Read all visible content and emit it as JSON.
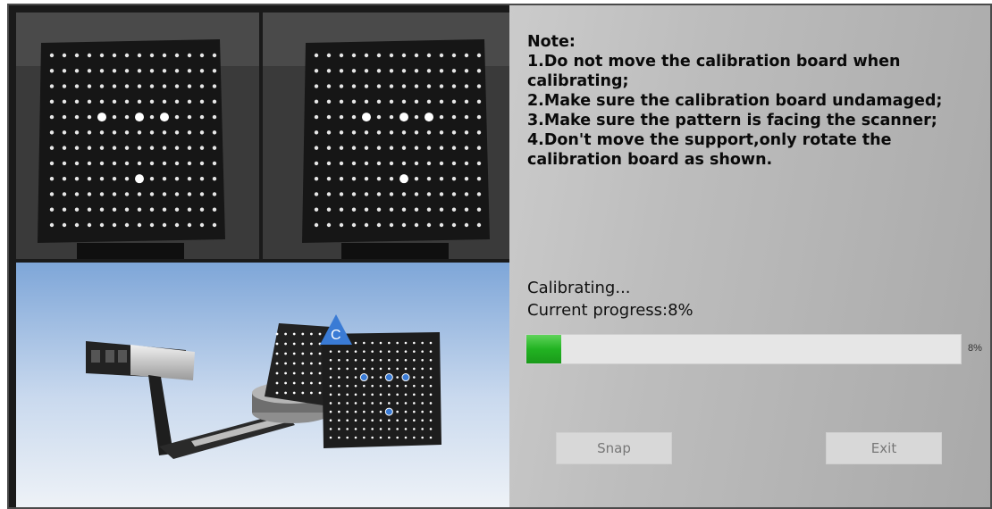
{
  "notes": {
    "heading": "Note:",
    "items": [
      "1.Do not move the calibration board when calibrating;",
      "2.Make sure the calibration board undamaged;",
      "3.Make sure the pattern is facing the scanner;",
      "4.Don't move the support,only rotate the calibration board as shown."
    ]
  },
  "status": {
    "calibrating": "Calibrating...",
    "current_progress": "Current progress:8%"
  },
  "progress": {
    "value": 0.08,
    "label": "8%"
  },
  "buttons": {
    "snap": "Snap",
    "exit": "Exit"
  },
  "illustration": {
    "badge": "C"
  },
  "colors": {
    "progress_fill": "#22b322",
    "accent_badge": "#3a7bd5",
    "board_dots": "#ffffff"
  }
}
